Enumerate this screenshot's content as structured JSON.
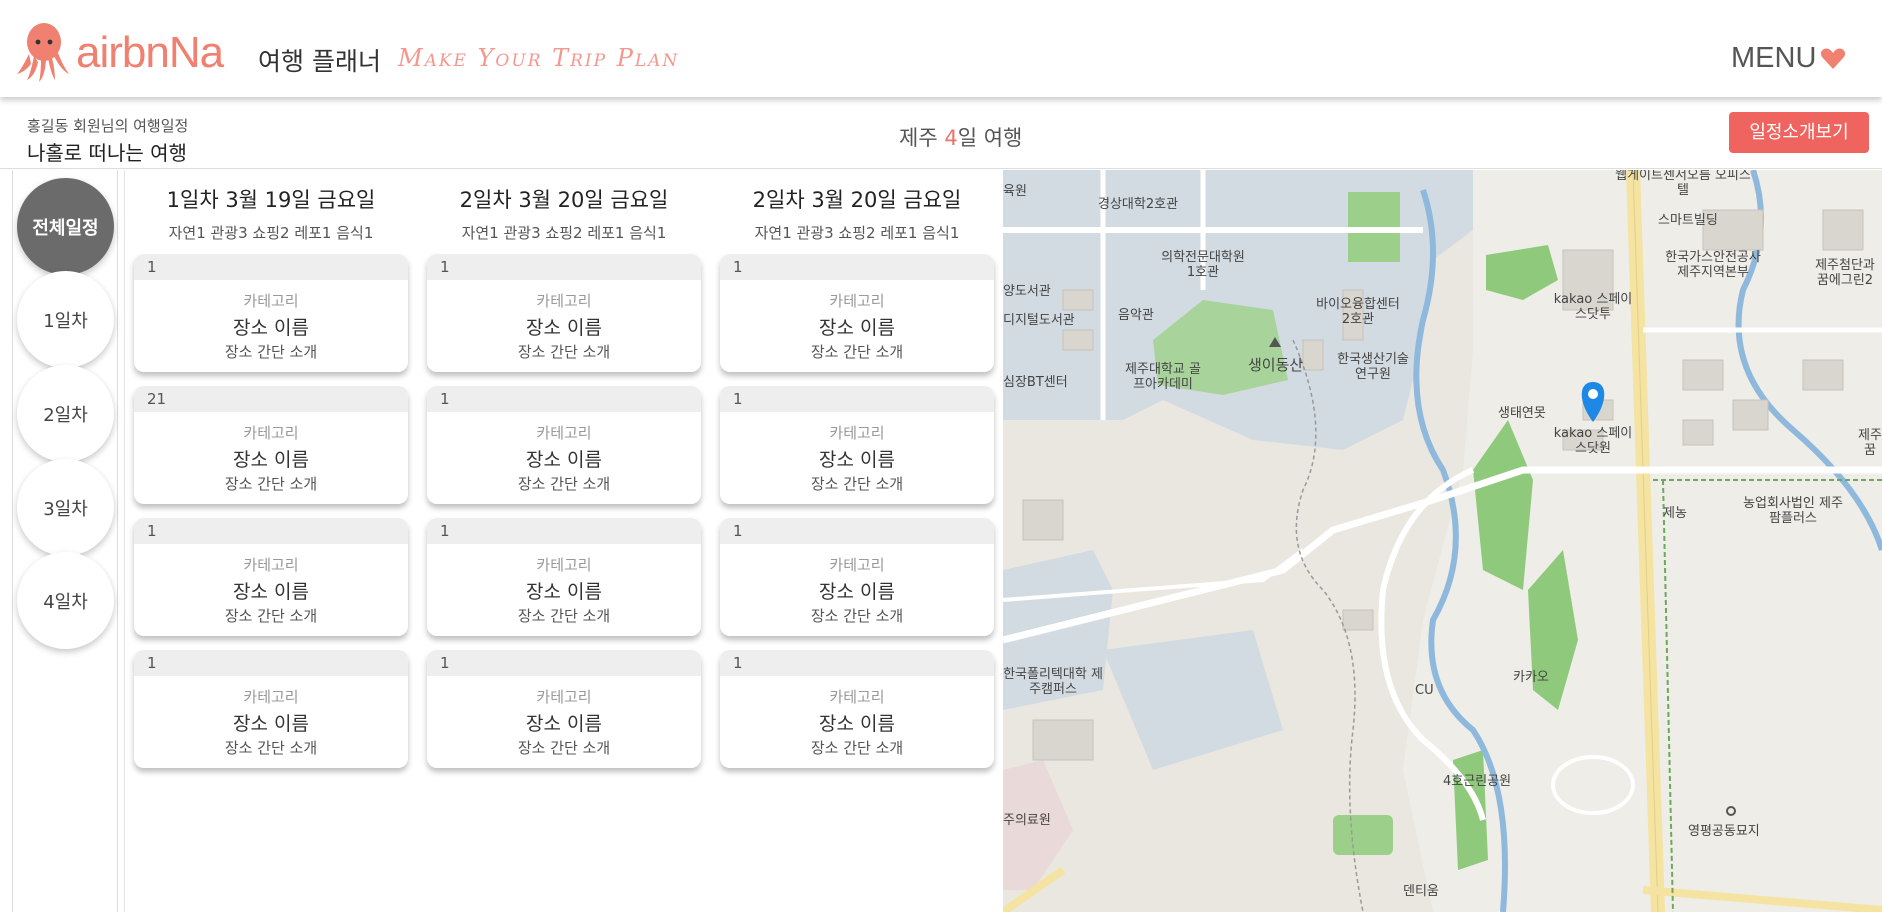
{
  "header": {
    "logo_text": "airbnNa",
    "app_name": "여행 플래너",
    "slogan": "Make Your Trip Plan",
    "menu_label": "MENU"
  },
  "subbar": {
    "owner_text": "홍길동 회원님의 여행일정",
    "trip_name": "나홀로 떠나는 여행",
    "title_prefix": "제주 ",
    "title_days": "4",
    "title_suffix": "일 여행",
    "intro_button": "일정소개보기"
  },
  "day_nav": [
    "전체일정",
    "1일차",
    "2일차",
    "3일차",
    "4일차"
  ],
  "columns": [
    {
      "title": "1일차 3월 19일 금요일",
      "summary": "자연1 관광3 쇼핑2 레포1 음식1",
      "cards": [
        {
          "num": "1",
          "category": "카테고리",
          "name": "장소 이름",
          "desc": "장소 간단 소개"
        },
        {
          "num": "21",
          "category": "카테고리",
          "name": "장소 이름",
          "desc": "장소 간단 소개"
        },
        {
          "num": "1",
          "category": "카테고리",
          "name": "장소 이름",
          "desc": "장소 간단 소개"
        },
        {
          "num": "1",
          "category": "카테고리",
          "name": "장소 이름",
          "desc": "장소 간단 소개"
        }
      ]
    },
    {
      "title": "2일차 3월 20일 금요일",
      "summary": "자연1 관광3 쇼핑2 레포1 음식1",
      "cards": [
        {
          "num": "1",
          "category": "카테고리",
          "name": "장소 이름",
          "desc": "장소 간단 소개"
        },
        {
          "num": "1",
          "category": "카테고리",
          "name": "장소 이름",
          "desc": "장소 간단 소개"
        },
        {
          "num": "1",
          "category": "카테고리",
          "name": "장소 이름",
          "desc": "장소 간단 소개"
        },
        {
          "num": "1",
          "category": "카테고리",
          "name": "장소 이름",
          "desc": "장소 간단 소개"
        }
      ]
    },
    {
      "title": "2일차 3월 20일 금요일",
      "summary": "자연1 관광3 쇼핑2 레포1 음식1",
      "cards": [
        {
          "num": "1",
          "category": "카테고리",
          "name": "장소 이름",
          "desc": "장소 간단 소개"
        },
        {
          "num": "1",
          "category": "카테고리",
          "name": "장소 이름",
          "desc": "장소 간단 소개"
        },
        {
          "num": "1",
          "category": "카테고리",
          "name": "장소 이름",
          "desc": "장소 간단 소개"
        },
        {
          "num": "1",
          "category": "카테고리",
          "name": "장소 이름",
          "desc": "장소 간단 소개"
        }
      ]
    }
  ],
  "map": {
    "labels": [
      "웹게이트센서오름 오피스텔",
      "경상대학2호관",
      "스마트빌딩",
      "의학전문대학원 1호관",
      "한국가스안전공사 제주지역본부",
      "제주첨단과 꿈에그린2",
      "양도서관",
      "kakao 스페이스닷투",
      "바이오융합센터 2호관",
      "디지털도서관",
      "음악관",
      "생이동산",
      "한국생산기술 연구원",
      "제주대학교 골프아카데미",
      "생태연못",
      "kakao 스페이스닷원",
      "제주 꿈",
      "심장BT센터",
      "제농",
      "농업회사법인 제주팜플러스",
      "한국폴리텍대학 제주캠퍼스",
      "CU",
      "카카오",
      "4호근린공원",
      "주의료원",
      "영평공동묘지",
      "덴티움",
      "육원"
    ],
    "accent_color": "#f0645f",
    "pin_color": "#1e88e5"
  }
}
